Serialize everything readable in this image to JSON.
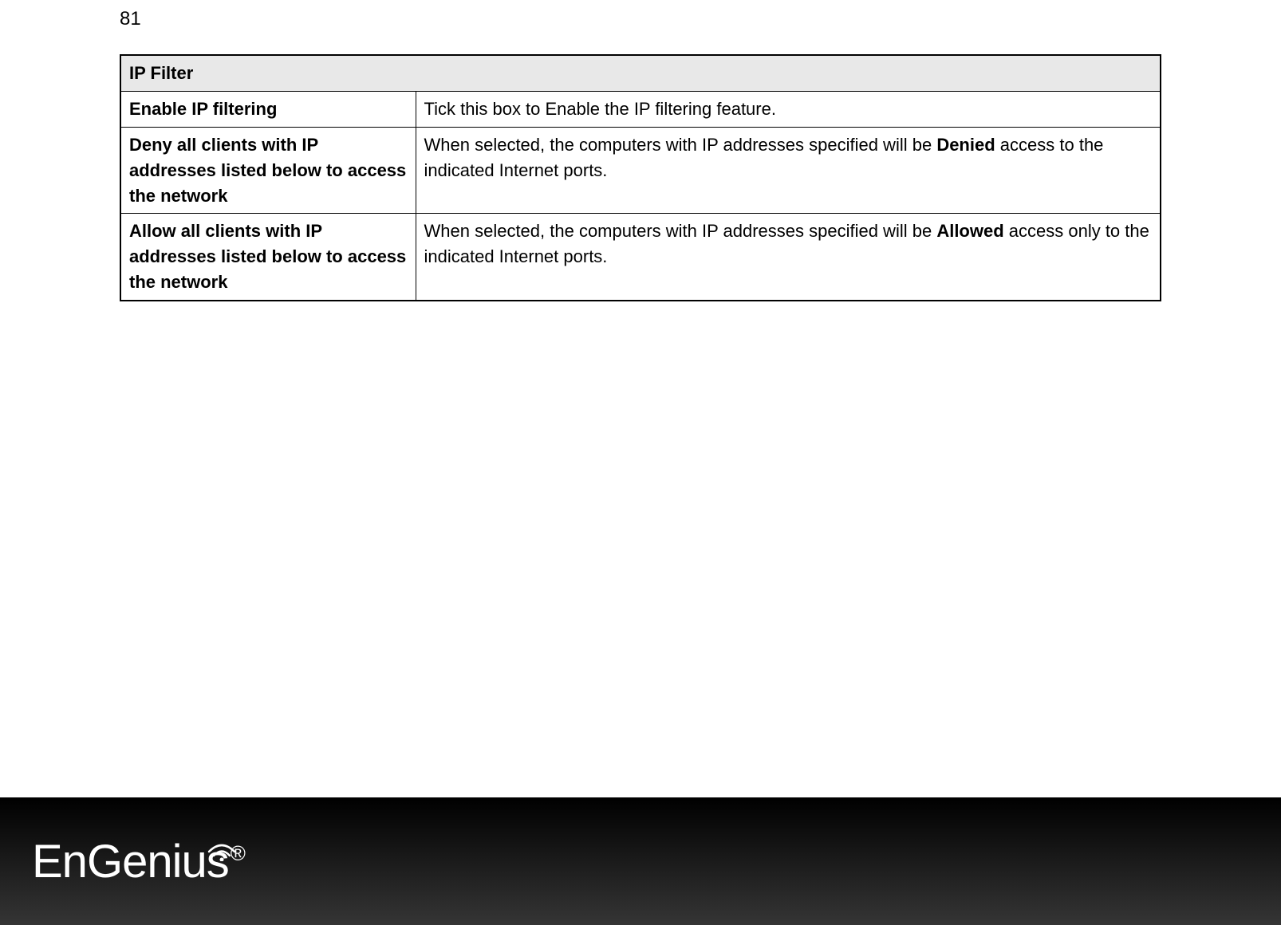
{
  "page": {
    "number": "81"
  },
  "table": {
    "header": "IP Filter",
    "rows": [
      {
        "label": "Enable IP filtering",
        "desc_prefix": "Tick this box to Enable the IP filtering feature.",
        "desc_bold": "",
        "desc_suffix": ""
      },
      {
        "label": "Deny all clients with IP addresses listed below to access the network",
        "desc_prefix": "When selected, the computers with IP addresses specified will be ",
        "desc_bold": "Denied",
        "desc_suffix": " access to the indicated Internet ports."
      },
      {
        "label": "Allow all clients with IP addresses listed below to access the network",
        "desc_prefix": "When selected, the computers with IP addresses specified will be ",
        "desc_bold": "Allowed",
        "desc_suffix": " access only to the indicated Internet ports."
      }
    ]
  },
  "footer": {
    "brand_part1": "En",
    "brand_part2": "Gen",
    "brand_part3": "ius",
    "reg": "®"
  }
}
